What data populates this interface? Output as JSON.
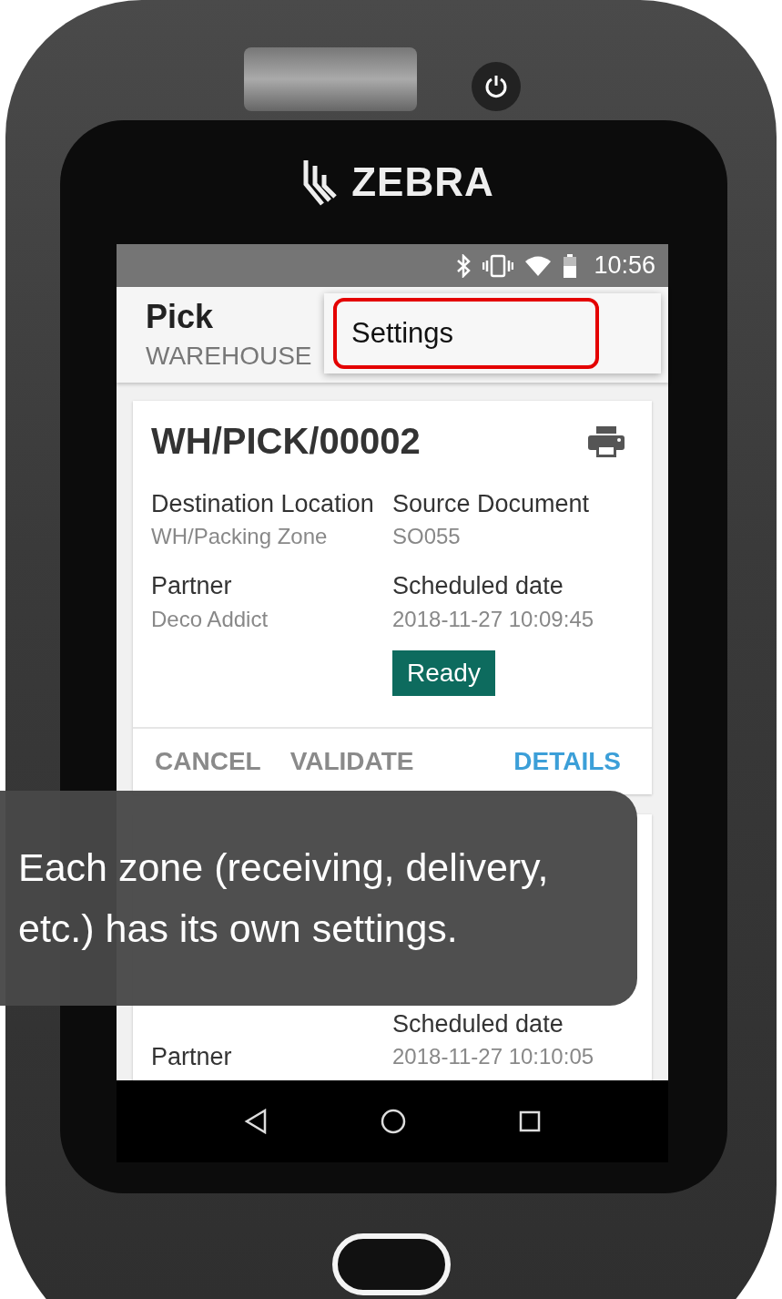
{
  "device": {
    "brand": "ZEBRA"
  },
  "status_bar": {
    "time": "10:56"
  },
  "app_bar": {
    "title": "Pick",
    "subtitle": "WAREHOUSE"
  },
  "menu": {
    "items": [
      {
        "label": "Settings",
        "highlighted": true
      }
    ]
  },
  "cards": [
    {
      "title": "WH/PICK/00002",
      "fields_left": [
        {
          "label": "Destination Location",
          "value": "WH/Packing Zone"
        },
        {
          "label": "Partner",
          "value": "Deco Addict"
        }
      ],
      "fields_right": [
        {
          "label": "Source Document",
          "value": "SO055"
        },
        {
          "label": "Scheduled date",
          "value": "2018-11-27 10:09:45"
        }
      ],
      "status": "Ready",
      "actions": [
        {
          "label": "CANCEL",
          "kind": "plain"
        },
        {
          "label": "VALIDATE",
          "kind": "plain"
        },
        {
          "label": "DETAILS",
          "kind": "primary"
        }
      ]
    },
    {
      "fields_left": [
        {
          "label": "Partner"
        }
      ],
      "fields_right": [
        {
          "label": "Scheduled date",
          "value": "2018-11-27 10:10:05"
        }
      ]
    }
  ],
  "tooltip": {
    "text": "Each zone (receiving, delivery, etc.) has its own settings."
  }
}
